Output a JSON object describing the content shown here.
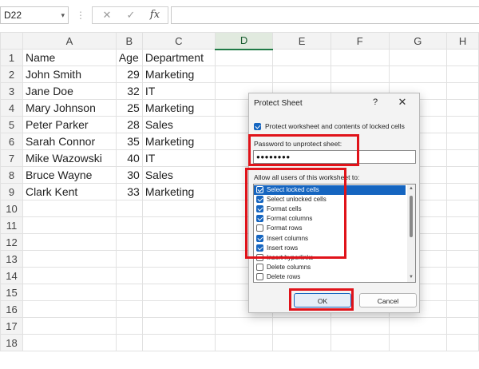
{
  "formula_bar": {
    "cell_ref": "D22",
    "dropdown_icon": "chevron-down-icon",
    "separator": "⋮",
    "cancel_symbol": "✕",
    "enter_symbol": "✓",
    "function_symbol": "fx"
  },
  "grid": {
    "columns": [
      "A",
      "B",
      "C",
      "D",
      "E",
      "F",
      "G",
      "H"
    ],
    "selected_column": "D",
    "row_numbers": [
      "1",
      "2",
      "3",
      "4",
      "5",
      "6",
      "7",
      "8",
      "9",
      "10",
      "11",
      "12",
      "13",
      "14",
      "15",
      "16",
      "17",
      "18"
    ],
    "rows": [
      [
        "Name",
        "Age",
        "Department"
      ],
      [
        "John Smith",
        "29",
        "Marketing"
      ],
      [
        "Jane Doe",
        "32",
        "IT"
      ],
      [
        "Mary Johnson",
        "25",
        "Marketing"
      ],
      [
        "Peter Parker",
        "28",
        "Sales"
      ],
      [
        "Sarah Connor",
        "35",
        "Marketing"
      ],
      [
        "Mike Wazowski",
        "40",
        "IT"
      ],
      [
        "Bruce Wayne",
        "30",
        "Sales"
      ],
      [
        "Clark Kent",
        "33",
        "Marketing"
      ]
    ]
  },
  "dialog": {
    "title": "Protect Sheet",
    "help": "?",
    "close": "✕",
    "protect_checkbox_label": "Protect worksheet and contents of locked cells",
    "protect_checked": true,
    "password_label": "Password to unprotect sheet:",
    "password_value": "●●●●●●●●",
    "allow_label": "Allow all users of this worksheet to:",
    "permissions": [
      {
        "label": "Select locked cells",
        "checked": true,
        "selected": true
      },
      {
        "label": "Select unlocked cells",
        "checked": true,
        "selected": false
      },
      {
        "label": "Format cells",
        "checked": true,
        "selected": false
      },
      {
        "label": "Format columns",
        "checked": true,
        "selected": false
      },
      {
        "label": "Format rows",
        "checked": false,
        "selected": false
      },
      {
        "label": "Insert columns",
        "checked": true,
        "selected": false
      },
      {
        "label": "Insert rows",
        "checked": true,
        "selected": false
      },
      {
        "label": "Insert hyperlinks",
        "checked": false,
        "selected": false
      },
      {
        "label": "Delete columns",
        "checked": false,
        "selected": false
      },
      {
        "label": "Delete rows",
        "checked": false,
        "selected": false
      }
    ],
    "ok_label": "OK",
    "cancel_label": "Cancel"
  },
  "colors": {
    "highlight_red": "#e0131a",
    "accent_blue": "#1565c0"
  }
}
